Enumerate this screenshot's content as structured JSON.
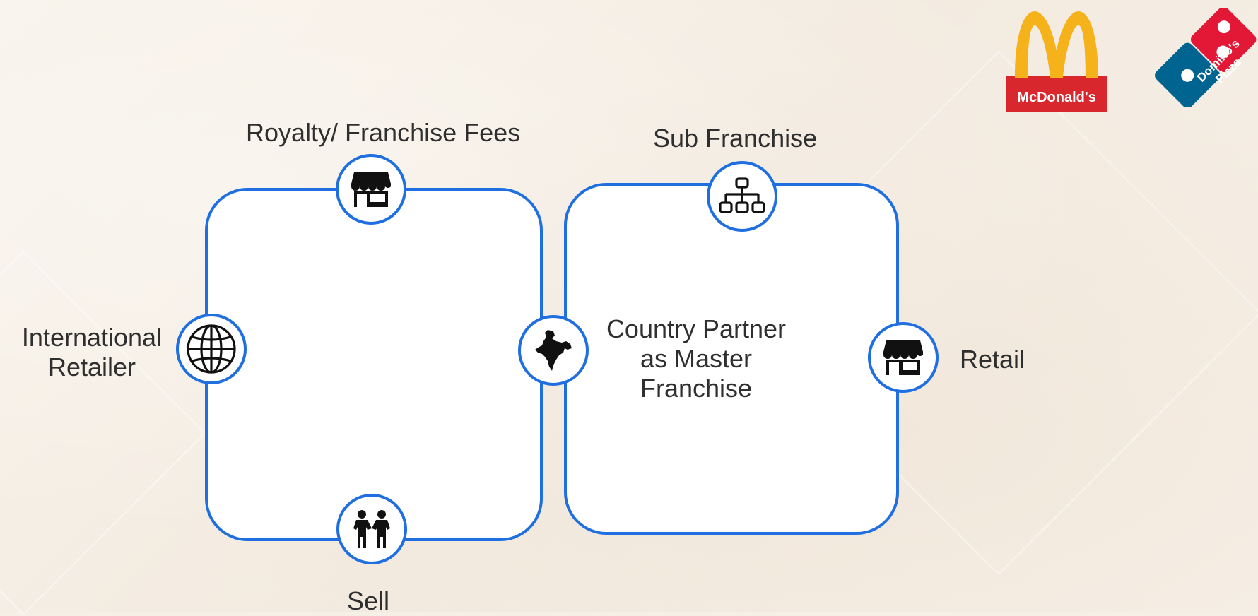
{
  "labels": {
    "royalty": "Royalty/ Franchise Fees",
    "sub_franchise": "Sub Franchise",
    "international_retailer": [
      "International",
      "Retailer"
    ],
    "country_partner": [
      "Country Partner",
      "as Master",
      "Franchise"
    ],
    "retail": "Retail",
    "sell": "Sell"
  },
  "logos": {
    "mcdonalds": "McDonald's",
    "dominos": [
      "Domino's",
      "Pizza"
    ]
  },
  "icons": [
    "store-icon",
    "hierarchy-icon",
    "globe-icon",
    "india-map-icon",
    "handshake-icon"
  ],
  "colors": {
    "accent": "#1f6fe0",
    "text": "#2f2f2f",
    "mcdonalds_red": "#d9272e",
    "mcdonalds_yellow": "#f6b21a",
    "dominos_blue": "#006491",
    "dominos_red": "#e31837"
  }
}
